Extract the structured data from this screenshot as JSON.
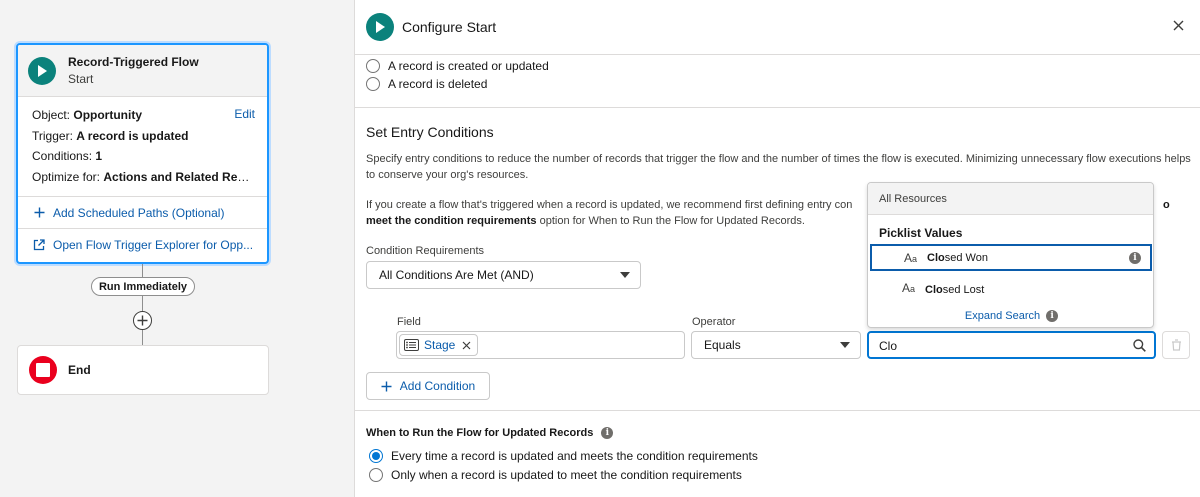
{
  "canvas": {
    "start": {
      "title": "Record-Triggered Flow",
      "subtitle": "Start",
      "object_label": "Object:",
      "object_value": "Opportunity",
      "edit_label": "Edit",
      "trigger_label": "Trigger:",
      "trigger_value": "A record is updated",
      "conditions_label": "Conditions:",
      "conditions_value": "1",
      "optimize_label": "Optimize for:",
      "optimize_value": "Actions and Related Rec...",
      "add_scheduled_paths": "Add Scheduled Paths (Optional)",
      "open_trigger_explorer": "Open Flow Trigger Explorer for Opp..."
    },
    "run_immediately": "Run Immediately",
    "end_label": "End"
  },
  "panel": {
    "title": "Configure Start",
    "trigger_options": [
      {
        "label": "A record is created or updated",
        "selected": false
      },
      {
        "label": "A record is deleted",
        "selected": false
      }
    ],
    "section_title": "Set Entry Conditions",
    "description": "Specify entry conditions to reduce the number of records that trigger the flow and the number of times the flow is executed. Minimizing unnecessary flow executions helps to conserve your org's resources.",
    "note_line1_prefix": "If you create a flow that's triggered when a record is updated, we recommend first defining entry con",
    "note_line1_suffix": "o",
    "note_line2_bold": "meet the condition requirements",
    "note_line2_rest": " option for When to Run the Flow for Updated Records.",
    "condition_requirements_label": "Condition Requirements",
    "condition_requirements_value": "All Conditions Are Met (AND)",
    "field_label": "Field",
    "field_value": "Stage",
    "operator_label": "Operator",
    "operator_value": "Equals",
    "value_input": "Clo",
    "add_condition": "Add Condition",
    "when_to_run_title": "When to Run the Flow for Updated Records",
    "when_options": [
      {
        "label": "Every time a record is updated and meets the condition requirements",
        "selected": true
      },
      {
        "label": "Only when a record is updated to meet the condition requirements",
        "selected": false
      }
    ]
  },
  "dropdown": {
    "tab": "All Resources",
    "group": "Picklist Values",
    "items": [
      {
        "match": "Clo",
        "rest": "sed Won",
        "active": true
      },
      {
        "match": "Clo",
        "rest": "sed Lost",
        "active": false
      }
    ],
    "expand_search": "Expand Search"
  },
  "colors": {
    "accent": "#0176d3",
    "link": "#0b5cab",
    "start_icon": "#0b827c",
    "end_icon": "#ea001e"
  }
}
